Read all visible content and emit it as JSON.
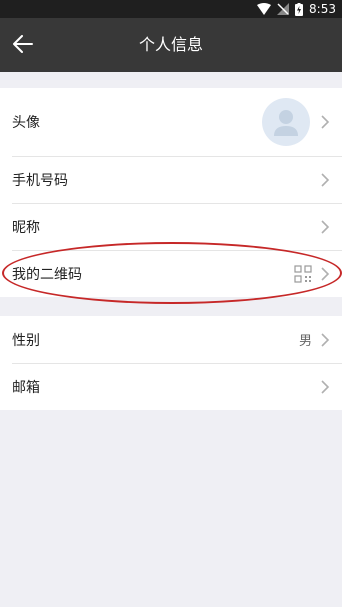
{
  "status_bar": {
    "time": "8:53",
    "icons": [
      "wifi-icon",
      "signal-icon",
      "battery-charging-icon"
    ]
  },
  "header": {
    "title": "个人信息",
    "back_icon": "arrow-left-icon"
  },
  "group1": {
    "avatar_label": "头像",
    "phone_label": "手机号码",
    "nickname_label": "昵称",
    "qrcode_label": "我的二维码"
  },
  "group2": {
    "gender_label": "性别",
    "gender_value": "男",
    "email_label": "邮箱"
  },
  "colors": {
    "header_bg": "#383838",
    "page_bg": "#efeff4",
    "highlight": "#c62828"
  }
}
